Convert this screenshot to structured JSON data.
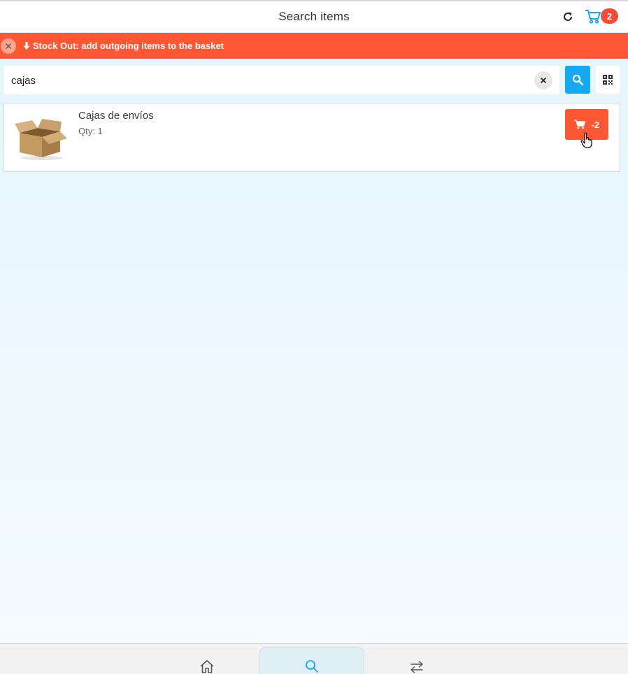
{
  "header": {
    "title": "Search items",
    "refresh_icon": "refresh-icon",
    "cart_icon": "cart-icon",
    "cart_count": "2",
    "cart_color": "#16a9f2",
    "badge_color": "#ef4d3a"
  },
  "banner": {
    "text": "Stock Out: add outgoing items to the basket",
    "icon": "arrow-down-icon",
    "close_icon": "close-icon",
    "color": "#ff5733"
  },
  "search": {
    "value": "cajas",
    "clear_icon": "close-icon",
    "search_icon": "search-icon",
    "qr_icon": "qr-code-icon",
    "button_color": "#16a9f2"
  },
  "results": [
    {
      "name": "Cajas de envíos",
      "qty_label": "Qty: 1",
      "image": "cardboard-box-image",
      "action_label": "-2",
      "action_icon": "cart-icon"
    }
  ],
  "nav": {
    "items": [
      {
        "name": "home",
        "icon": "home-icon"
      },
      {
        "name": "search",
        "icon": "search-icon",
        "active": true
      },
      {
        "name": "transfer",
        "icon": "swap-arrows-icon"
      }
    ]
  }
}
